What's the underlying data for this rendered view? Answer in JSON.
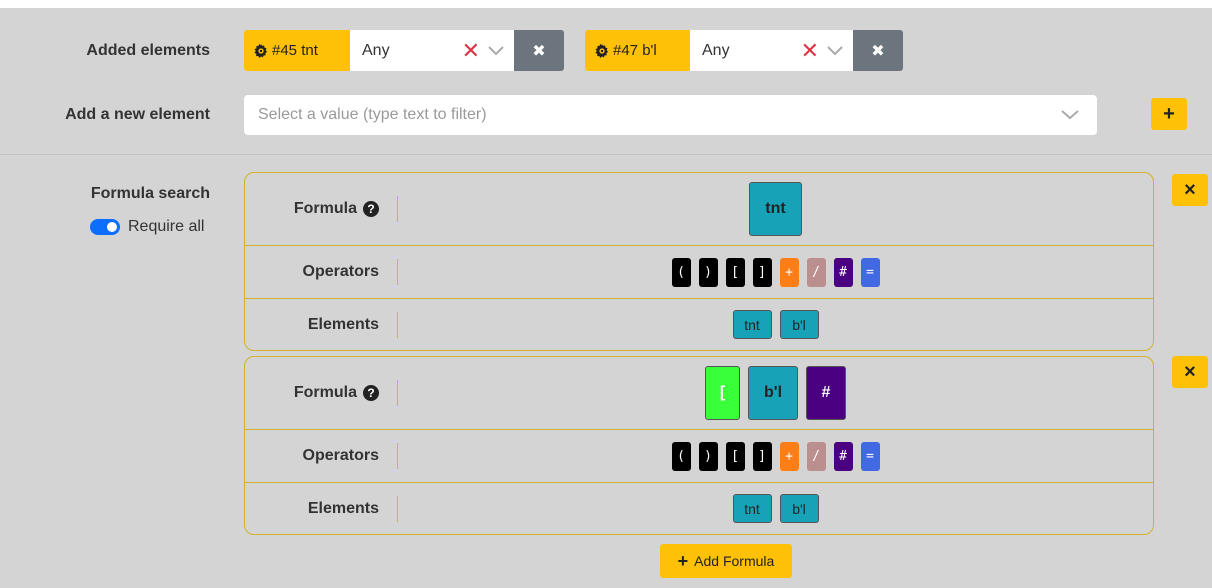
{
  "labels": {
    "added_elements": "Added elements",
    "add_new_element": "Add a new element",
    "formula_search": "Formula search",
    "require_all": "Require all"
  },
  "added": [
    {
      "tag": "#45 tnt",
      "value": "Any"
    },
    {
      "tag": "#47 b'l",
      "value": "Any"
    }
  ],
  "new_element": {
    "placeholder": "Select a value (type text to filter)"
  },
  "add_button": "+",
  "formulas": [
    {
      "formula_label": "Formula",
      "formula_items": [
        {
          "text": "tnt",
          "color": "#17a2b8"
        }
      ],
      "operators_label": "Operators",
      "elements_label": "Elements",
      "remove": "×"
    },
    {
      "formula_label": "Formula",
      "formula_items": [
        {
          "text": "[",
          "color": "#39ff3a"
        },
        {
          "text": "b'l",
          "color": "#17a2b8"
        },
        {
          "text": "#",
          "color": "#4b0082"
        }
      ],
      "operators_label": "Operators",
      "elements_label": "Elements",
      "remove": "×"
    }
  ],
  "operators": [
    {
      "text": "(",
      "color": "#000000"
    },
    {
      "text": ")",
      "color": "#000000"
    },
    {
      "text": "[",
      "color": "#000000"
    },
    {
      "text": "]",
      "color": "#000000"
    },
    {
      "text": "+",
      "color": "#fd7e14"
    },
    {
      "text": "/",
      "color": "#bc8f8f"
    },
    {
      "text": "#",
      "color": "#4b0082"
    },
    {
      "text": "=",
      "color": "#4169e1"
    }
  ],
  "elements": [
    "tnt",
    "b'l"
  ],
  "add_formula": "Add Formula",
  "colors": {
    "accent": "#ffc107",
    "teal": "#17a2b8",
    "toggle": "#0d6efd",
    "delete": "#6c757d"
  }
}
